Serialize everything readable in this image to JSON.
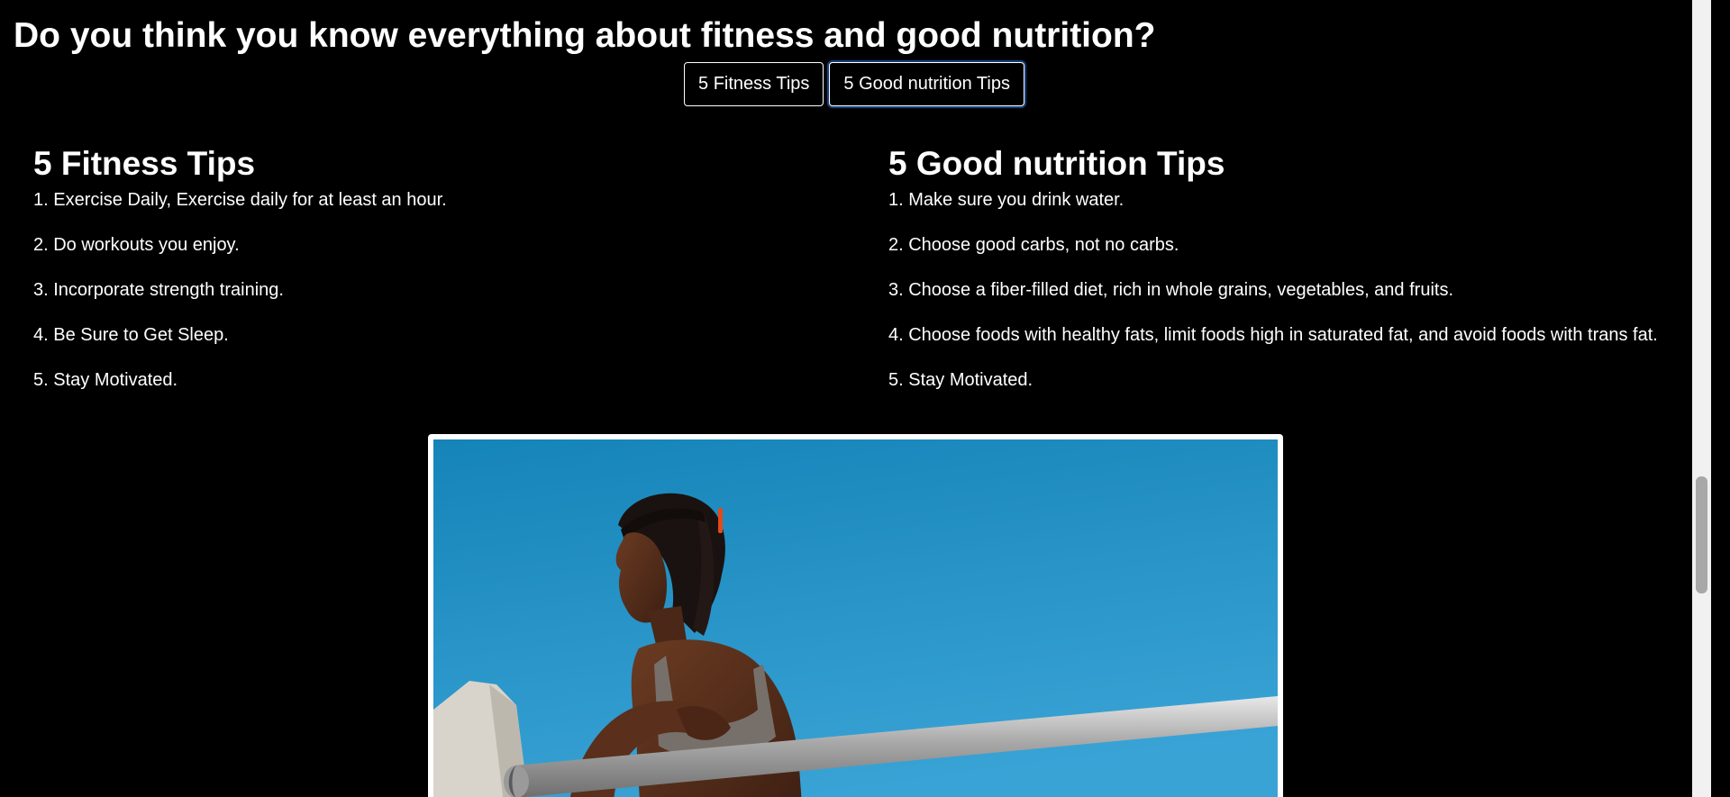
{
  "heading": "Do you think you know everything about fitness and good nutrition?",
  "tabs": [
    {
      "label": "5 Fitness Tips"
    },
    {
      "label": "5 Good nutrition Tips"
    }
  ],
  "fitness": {
    "title": "5 Fitness Tips",
    "tips": [
      "1. Exercise Daily, Exercise daily for at least an hour.",
      "2. Do workouts you enjoy.",
      "3. Incorporate strength training.",
      "4. Be Sure to Get Sleep.",
      "5. Stay Motivated."
    ]
  },
  "nutrition": {
    "title": "5 Good nutrition Tips",
    "tips": [
      "1. Make sure you drink water.",
      "2. Choose good carbs, not no carbs.",
      "3. Choose a fiber-filled diet, rich in whole grains, vegetables, and fruits.",
      "4. Choose foods with healthy fats, limit foods high in saturated fat, and avoid foods with trans fat.",
      "5. Stay Motivated."
    ]
  },
  "colors": {
    "background": "#000000",
    "text": "#ffffff",
    "sky": "#1f8fc4",
    "focus_ring": "#2c5aa8"
  }
}
